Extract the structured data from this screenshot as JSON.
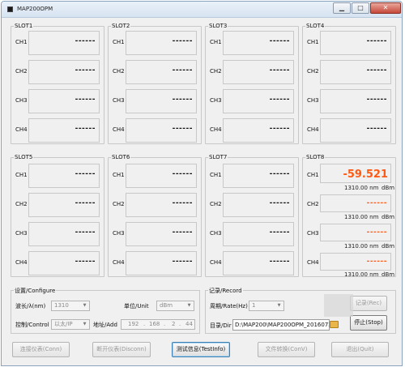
{
  "window": {
    "title": "MAP200OPM",
    "minimize_glyph": "▁",
    "maximize_glyph": "□",
    "close_glyph": "✕"
  },
  "slots": [
    {
      "name": "SLOT1",
      "channels": [
        {
          "label": "CH1",
          "value": "------"
        },
        {
          "label": "CH2",
          "value": "------"
        },
        {
          "label": "CH3",
          "value": "------"
        },
        {
          "label": "CH4",
          "value": "------"
        }
      ]
    },
    {
      "name": "SLOT2",
      "channels": [
        {
          "label": "CH1",
          "value": "------"
        },
        {
          "label": "CH2",
          "value": "------"
        },
        {
          "label": "CH3",
          "value": "------"
        },
        {
          "label": "CH4",
          "value": "------"
        }
      ]
    },
    {
      "name": "SLOT3",
      "channels": [
        {
          "label": "CH1",
          "value": "------"
        },
        {
          "label": "CH2",
          "value": "------"
        },
        {
          "label": "CH3",
          "value": "------"
        },
        {
          "label": "CH4",
          "value": "------"
        }
      ]
    },
    {
      "name": "SLOT4",
      "channels": [
        {
          "label": "CH1",
          "value": "------"
        },
        {
          "label": "CH2",
          "value": "------"
        },
        {
          "label": "CH3",
          "value": "------"
        },
        {
          "label": "CH4",
          "value": "------"
        }
      ]
    },
    {
      "name": "SLOT5",
      "channels": [
        {
          "label": "CH1",
          "value": "------"
        },
        {
          "label": "CH2",
          "value": "------"
        },
        {
          "label": "CH3",
          "value": "------"
        },
        {
          "label": "CH4",
          "value": "------"
        }
      ]
    },
    {
      "name": "SLOT6",
      "channels": [
        {
          "label": "CH1",
          "value": "------"
        },
        {
          "label": "CH2",
          "value": "------"
        },
        {
          "label": "CH3",
          "value": "------"
        },
        {
          "label": "CH4",
          "value": "------"
        }
      ]
    },
    {
      "name": "SLOT7",
      "channels": [
        {
          "label": "CH1",
          "value": "------"
        },
        {
          "label": "CH2",
          "value": "------"
        },
        {
          "label": "CH3",
          "value": "------"
        },
        {
          "label": "CH4",
          "value": "------"
        }
      ]
    },
    {
      "name": "SLOT8",
      "channels": [
        {
          "label": "CH1",
          "value": "-59.521",
          "wavelength": "1310.00 nm",
          "unit": "dBm"
        },
        {
          "label": "CH2",
          "value": "------",
          "wavelength": "1310.00 nm",
          "unit": "dBm"
        },
        {
          "label": "CH3",
          "value": "------",
          "wavelength": "1310.00 nm",
          "unit": "dBm"
        },
        {
          "label": "CH4",
          "value": "------",
          "wavelength": "1310.00 nm",
          "unit": "dBm"
        }
      ]
    }
  ],
  "colors": {
    "active_reading": "#ff5a14",
    "inactive_reading": "#111111"
  },
  "configure": {
    "title": "设置/Configure",
    "wavelength_label": "波长/λ(nm)",
    "wavelength_value": "1310",
    "unit_label": "单位/Unit",
    "unit_value": "dBm",
    "control_label": "控制/Control",
    "control_value": "以太/IP",
    "address_label": "地址/Add",
    "ip": [
      "192",
      "168",
      "2",
      "44"
    ]
  },
  "record": {
    "title": "记录/Record",
    "rate_label": "周期/Rate(Hz)",
    "rate_value": "1",
    "dir_label": "目录/Dir",
    "dir_value": "D:\\MAP200\\MAP200OPM_2016072(",
    "record_button": "记录(Rec)",
    "stop_button": "停止(Stop)"
  },
  "buttons": {
    "connect": "连接仪表(Conn)",
    "disconnect": "断开仪表(Disconn)",
    "test_info": "测试信息(TestInfo)",
    "convert": "文件转换(ConV)",
    "quit": "退出(Quit)"
  }
}
